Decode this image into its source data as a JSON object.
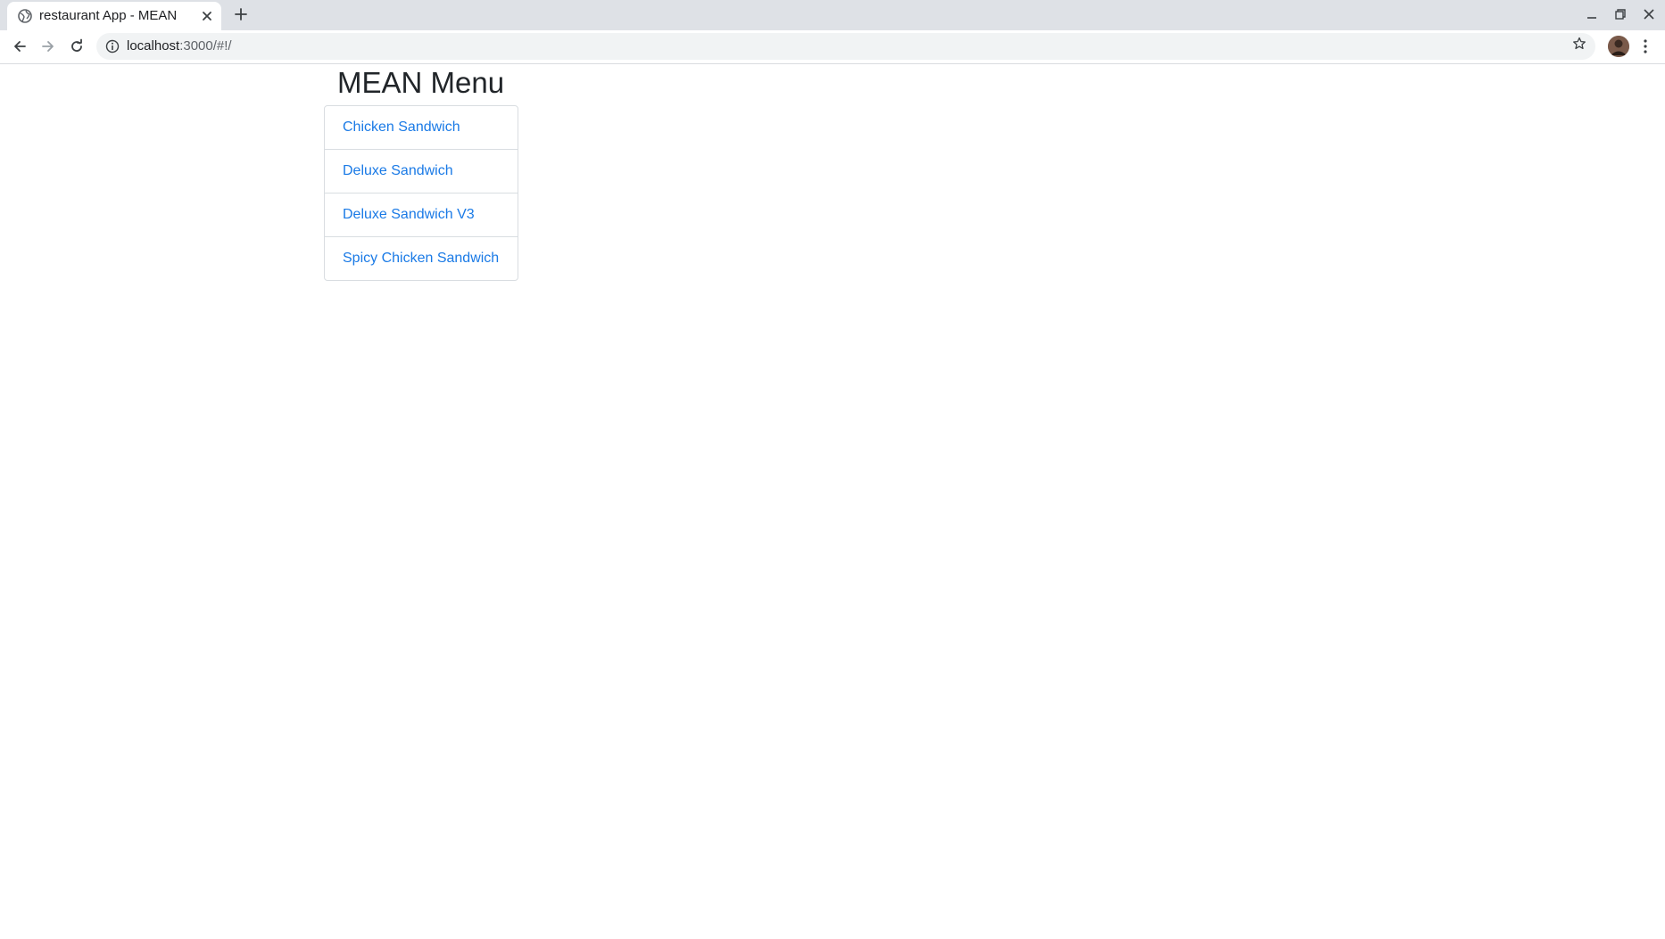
{
  "browser": {
    "tab_title": "restaurant App - MEAN",
    "url_host": "localhost",
    "url_rest": ":3000/#!/"
  },
  "page": {
    "title": "MEAN Menu",
    "menu_items": [
      {
        "label": "Chicken Sandwich"
      },
      {
        "label": "Deluxe Sandwich"
      },
      {
        "label": "Deluxe Sandwich V3"
      },
      {
        "label": "Spicy Chicken Sandwich"
      }
    ]
  },
  "icons": {
    "tab_favicon": "globe-icon",
    "tab_close": "close-icon",
    "new_tab": "plus-icon",
    "back": "back-arrow-icon",
    "forward": "forward-arrow-icon",
    "reload": "reload-icon",
    "site_info": "info-icon",
    "bookmark": "star-icon",
    "profile": "avatar",
    "menu": "kebab-menu-icon",
    "minimize": "minimize-icon",
    "restore": "restore-icon",
    "close_window": "close-window-icon"
  },
  "colors": {
    "link": "#1a7ae6",
    "heading": "#212529",
    "chrome_bg": "#dee1e6"
  }
}
